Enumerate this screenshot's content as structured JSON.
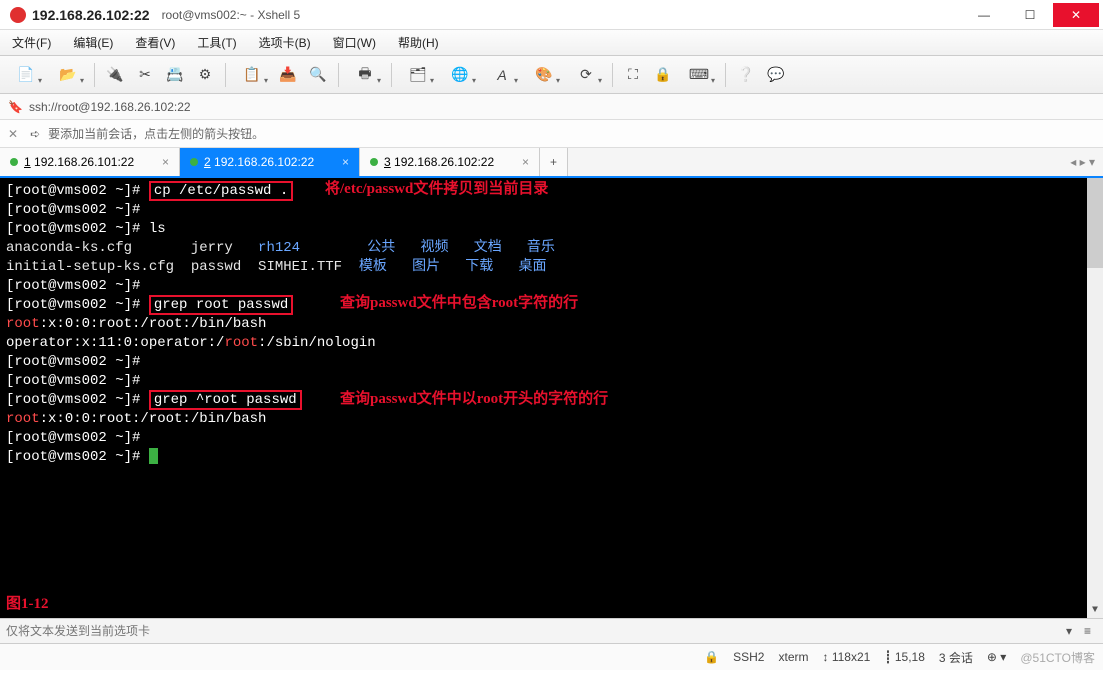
{
  "titlebar": {
    "ip": "192.168.26.102:22",
    "subtitle": "root@vms002:~ - Xshell 5"
  },
  "menu": {
    "file": "文件(F)",
    "edit": "编辑(E)",
    "view": "查看(V)",
    "tools": "工具(T)",
    "tab": "选项卡(B)",
    "window": "窗口(W)",
    "help": "帮助(H)"
  },
  "address": {
    "url": "ssh://root@192.168.26.102:22"
  },
  "tip": {
    "text": "要添加当前会话，点击左侧的箭头按钮。"
  },
  "tabs": [
    {
      "num": "1",
      "label": "192.168.26.101:22",
      "active": false
    },
    {
      "num": "2",
      "label": "192.168.26.102:22",
      "active": true
    },
    {
      "num": "3",
      "label": "192.168.26.102:22",
      "active": false
    }
  ],
  "term": {
    "prompt": "[root@vms002 ~]#",
    "cmd_cp": "cp /etc/passwd .",
    "ann_cp": "将/etc/passwd文件拷贝到当前目录",
    "cmd_ls": "ls",
    "ls_row1_white": "anaconda-ks.cfg       jerry   ",
    "ls_row1_rh": "rh124",
    "ls_row1_cn": "公共   视频   文档   音乐",
    "ls_row2_white": "initial-setup-ks.cfg  passwd  SIMHEI.TTF  ",
    "ls_row2_cn": "模板   图片   下载   桌面",
    "cmd_grep1": "grep root passwd",
    "ann_grep1": "查询passwd文件中包含root字符的行",
    "out_grep1_a_pre": "root",
    "out_grep1_a_mid": ":x:0:0:root:/root:/bin/bash",
    "out_grep1_b_pre": "operator:x:11:0:operator:/",
    "out_grep1_b_hl": "root",
    "out_grep1_b_post": ":/sbin/nologin",
    "cmd_grep2": "grep ^root passwd",
    "ann_grep2": "查询passwd文件中以root开头的字符的行",
    "out_grep2_pre": "root",
    "out_grep2_post": ":x:0:0:root:/root:/bin/bash",
    "figlabel": "图1-12"
  },
  "send": {
    "placeholder": "仅将文本发送到当前选项卡"
  },
  "status": {
    "proto": "SSH2",
    "term": "xterm",
    "size": "118x21",
    "pos": "15,18",
    "sess": "3 会话",
    "watermark": "@51CTO博客"
  }
}
